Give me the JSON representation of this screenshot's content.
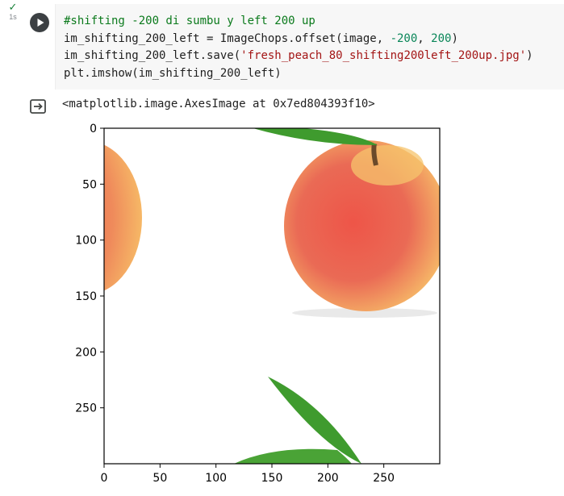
{
  "cell": {
    "status_check": "✓",
    "exec_time": "1s",
    "code_lines": {
      "comment": "#shifting -200 di sumbu y left 200 up",
      "line2_a": "im_shifting_200_left = ImageChops.offset(image, ",
      "line2_n1": "-200",
      "line2_sep": ", ",
      "line2_n2": "200",
      "line2_end": ")",
      "line3_a": "im_shifting_200_left.save(",
      "line3_str": "'fresh_peach_80_shifting200left_200up.jpg'",
      "line3_end": ")",
      "line4": "plt.imshow(im_shifting_200_left)"
    },
    "output_text": "<matplotlib.image.AxesImage at 0x7ed804393f10>"
  },
  "chart_data": {
    "type": "image",
    "x_ticks": [
      "0",
      "50",
      "100",
      "150",
      "200",
      "250"
    ],
    "y_ticks": [
      "0",
      "50",
      "100",
      "150",
      "200",
      "250"
    ],
    "x_tick_values": [
      0,
      50,
      100,
      150,
      200,
      250
    ],
    "y_tick_values": [
      0,
      50,
      100,
      150,
      200,
      250
    ],
    "xlim": [
      0,
      300
    ],
    "ylim": [
      300,
      0
    ],
    "colors": {
      "peach_red": "#ea5a4f",
      "peach_yellow": "#f7c36a",
      "leaf_green": "#3f9b2e",
      "stem": "#6b4a2a"
    }
  }
}
